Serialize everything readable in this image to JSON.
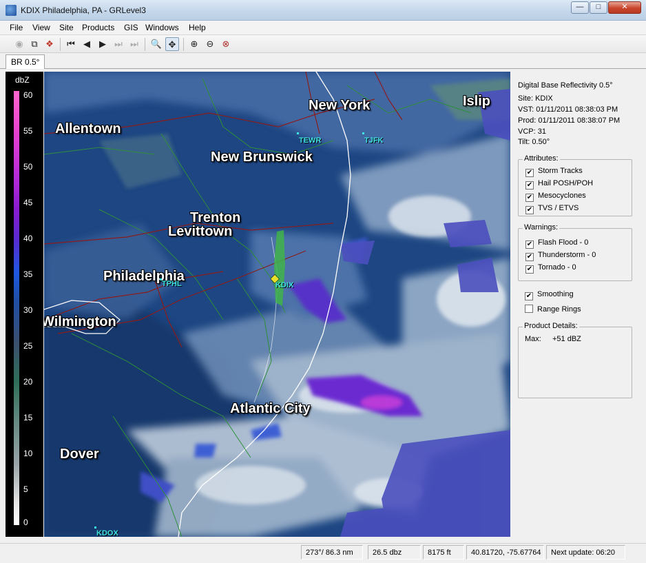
{
  "window": {
    "title": "KDIX Philadelphia, PA - GRLevel3"
  },
  "menu": [
    "File",
    "View",
    "Site",
    "Products",
    "GIS",
    "Windows",
    "Help"
  ],
  "toolbar_icons": [
    "zoom-out-all-icon",
    "copy-icon",
    "stop-icon",
    "first-frame-icon",
    "prev-frame-icon",
    "play-icon",
    "next-frame-icon",
    "last-frame-icon",
    "zoom-icon",
    "pan-icon",
    "zoom-in-icon",
    "zoom-out-icon",
    "zoom-reset-icon"
  ],
  "tabs": [
    {
      "label": "BR 0.5°"
    }
  ],
  "legend": {
    "unit": "dbZ",
    "ticks": [
      "60",
      "55",
      "50",
      "45",
      "40",
      "35",
      "30",
      "25",
      "20",
      "15",
      "10",
      "5",
      "0"
    ]
  },
  "map": {
    "cities": [
      "Allentown",
      "New York",
      "Islip",
      "New Brunswick",
      "Trenton",
      "Levittown",
      "Philadelphia",
      "Wilmington",
      "Atlantic City",
      "Dover"
    ],
    "stations": [
      "TEWR",
      "TJFK",
      "TPHL",
      "KDIX",
      "KDOX"
    ]
  },
  "panel": {
    "product": "Digital Base Reflectivity 0.5°",
    "site": "Site:  KDIX",
    "vst": "VST:  01/11/2011  08:38:03 PM",
    "prod": "Prod: 01/11/2011  08:38:07 PM",
    "vcp": "VCP:  31",
    "tilt": "Tilt:   0.50°",
    "attributes_title": "Attributes:",
    "attributes": [
      {
        "label": "Storm Tracks",
        "checked": true
      },
      {
        "label": "Hail POSH/POH",
        "checked": true
      },
      {
        "label": "Mesocyclones",
        "checked": true
      },
      {
        "label": "TVS / ETVS",
        "checked": true
      }
    ],
    "warnings_title": "Warnings:",
    "warnings": [
      {
        "label": "Flash Flood - 0",
        "checked": true
      },
      {
        "label": "Thunderstorm - 0",
        "checked": true
      },
      {
        "label": "Tornado - 0",
        "checked": true
      }
    ],
    "smoothing": {
      "label": "Smoothing",
      "checked": true
    },
    "range_rings": {
      "label": "Range Rings",
      "checked": false
    },
    "details_title": "Product Details:",
    "max_label": "Max:",
    "max_value": "+51 dBZ"
  },
  "status": {
    "bearing": "273°/ 86.3 nm",
    "dbz": "26.5 dbz",
    "height": "8175 ft",
    "coords": "40.81720, -75.67764",
    "next_update": "Next update: 06:20"
  }
}
